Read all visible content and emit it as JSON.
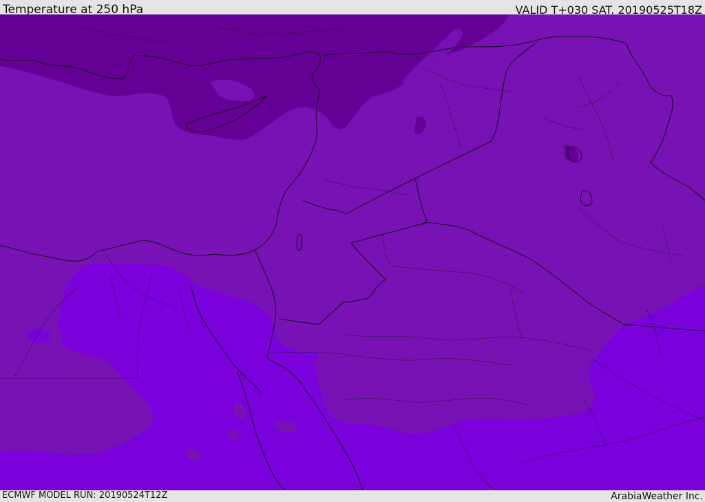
{
  "header": {
    "title": "Temperature at 250 hPa",
    "valid": "VALID T+030 SAT. 20190525T18Z"
  },
  "footer": {
    "model_run": "ECMWF MODEL RUN: 20190524T12Z",
    "credit": "ArabiaWeather Inc."
  },
  "map": {
    "colors": {
      "coldest_band": "#640096",
      "middle_band": "#7812b4",
      "warm_band": "#7a00dc",
      "border": "#111111"
    }
  }
}
